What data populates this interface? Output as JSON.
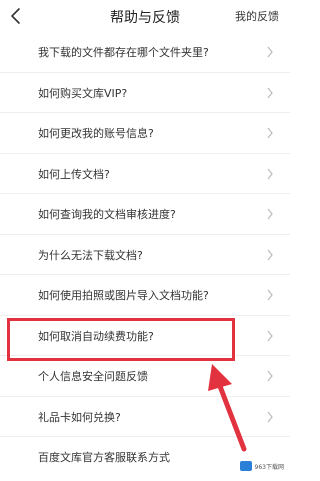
{
  "header": {
    "title": "帮助与反馈",
    "right_action": "我的反馈",
    "back_icon": "chevron-left-icon"
  },
  "faq": {
    "items": [
      {
        "label": "我下载的文件都存在哪个文件夹里?"
      },
      {
        "label": "如何购买文库VIP?"
      },
      {
        "label": "如何更改我的账号信息?"
      },
      {
        "label": "如何上传文档?"
      },
      {
        "label": "如何查询我的文档审核进度?"
      },
      {
        "label": "为什么无法下载文档?"
      },
      {
        "label": "如何使用拍照或图片导入文档功能?"
      },
      {
        "label": "如何取消自动续费功能?"
      },
      {
        "label": "个人信息安全问题反馈"
      },
      {
        "label": "礼品卡如何兑换?"
      },
      {
        "label": "百度文库官方客服联系方式"
      }
    ],
    "chevron_icon": "chevron-right-icon",
    "highlight_index": 7
  },
  "annotation": {
    "highlight_color": "#e2323f",
    "arrow_color": "#e2323f"
  },
  "watermark": {
    "text": "963下载网"
  }
}
